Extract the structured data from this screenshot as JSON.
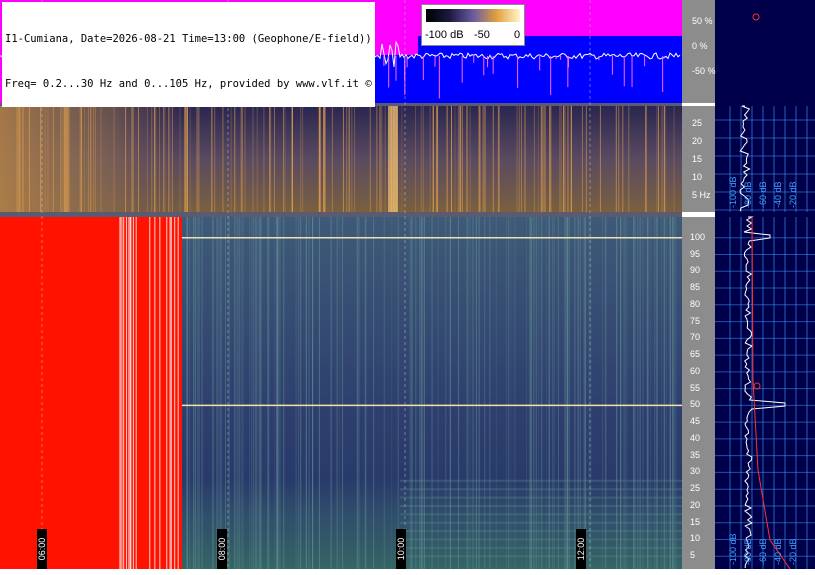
{
  "header": {
    "line1": "I1-Cumiana, Date=2026-08-21 Time=13:00 (Geophone/E-field))",
    "line2": "Freq= 0.2...30 Hz and 0...105 Hz, provided by www.vlf.it ©"
  },
  "colorscale": {
    "labels": [
      "-100 dB",
      "-50",
      "0"
    ]
  },
  "time_labels": [
    "06:00",
    "08:00",
    "10:00",
    "12:00"
  ],
  "colors": {
    "background": "#ffffff",
    "magenta": "#ff00ff",
    "blue": "#0000ff",
    "saturation_red": "#ff1200",
    "spectro_dark": "#101445",
    "axis_bg": "#8c8c8c",
    "side_bg": "#00004a",
    "grid": "#3f9fff"
  },
  "chart_data": [
    {
      "type": "area",
      "name": "amplitude-strip",
      "y_ticks": [
        "50 %",
        "0 %",
        "-50 %"
      ],
      "ylim": [
        -100,
        100
      ]
    },
    {
      "type": "heatmap",
      "name": "low-frequency-spectrogram",
      "x_ticks": [
        "06:00",
        "08:00",
        "10:00",
        "12:00"
      ],
      "y_ticks": [
        "25",
        "20",
        "15",
        "10",
        "5 Hz"
      ],
      "ylim": [
        0.2,
        30
      ],
      "colorscale": [
        "-100 dB",
        "-50",
        "0"
      ]
    },
    {
      "type": "heatmap",
      "name": "high-frequency-spectrogram",
      "x_ticks": [
        "06:00",
        "08:00",
        "10:00",
        "12:00"
      ],
      "y_ticks": [
        "100",
        "95",
        "90",
        "85",
        "80",
        "75",
        "70",
        "65",
        "60",
        "55",
        "50",
        "45",
        "40",
        "35",
        "30",
        "25",
        "20",
        "15",
        "10",
        "5"
      ],
      "ylim": [
        0,
        105
      ],
      "line_frequencies": [
        50,
        100
      ]
    },
    {
      "type": "line",
      "name": "low-freq-side-spectrum",
      "x_ticks": [
        "-100 dB",
        "-80 dB",
        "-60 dB",
        "-40 dB",
        "-20 dB"
      ]
    },
    {
      "type": "line",
      "name": "high-freq-side-spectrum",
      "x_ticks": [
        "-100 dB",
        "-80 dB",
        "-60 dB",
        "-40 dB",
        "-20 dB"
      ],
      "peaks_hz": [
        50,
        100
      ]
    }
  ]
}
